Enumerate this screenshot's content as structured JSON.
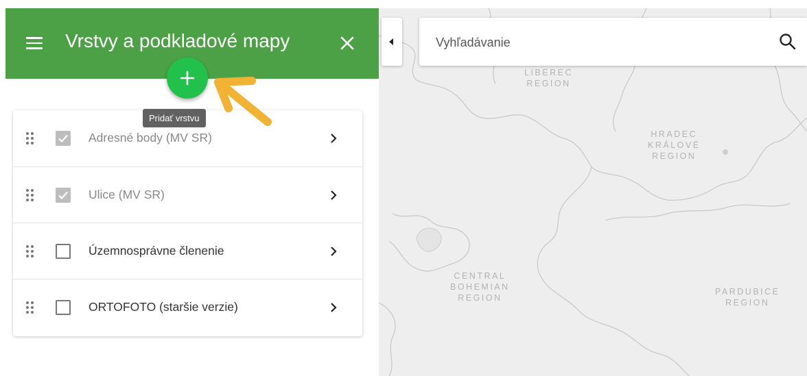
{
  "panel": {
    "title": "Vrstvy a podkladové mapy",
    "add_tooltip": "Pridať vrstvu",
    "layers": [
      {
        "label": "Adresné body (MV SR)",
        "checked": true
      },
      {
        "label": "Ulice (MV SR)",
        "checked": true
      },
      {
        "label": "Územnosprávne členenie",
        "checked": false
      },
      {
        "label": "ORTOFOTO (staršie verzie)",
        "checked": false
      }
    ]
  },
  "search": {
    "placeholder": "Vyhľadávanie"
  },
  "map": {
    "regions": [
      {
        "lines": [
          "LIBEREC",
          "REGION"
        ]
      },
      {
        "lines": [
          "HRADEC",
          "KRÁLOVÉ",
          "REGION"
        ]
      },
      {
        "lines": [
          "CENTRAL",
          "BOHEMIAN",
          "REGION"
        ]
      },
      {
        "lines": [
          "PARDUBICE",
          "REGION"
        ]
      }
    ]
  },
  "colors": {
    "header": "#4ca146",
    "fab": "#22c14c",
    "arrow": "#f2b233",
    "map_bg": "#eeeeee"
  },
  "icons": [
    "menu-icon",
    "close-icon",
    "plus-icon",
    "search-icon",
    "drag-handle-icon",
    "check-icon",
    "chevron-right-icon",
    "chevron-left-icon"
  ]
}
